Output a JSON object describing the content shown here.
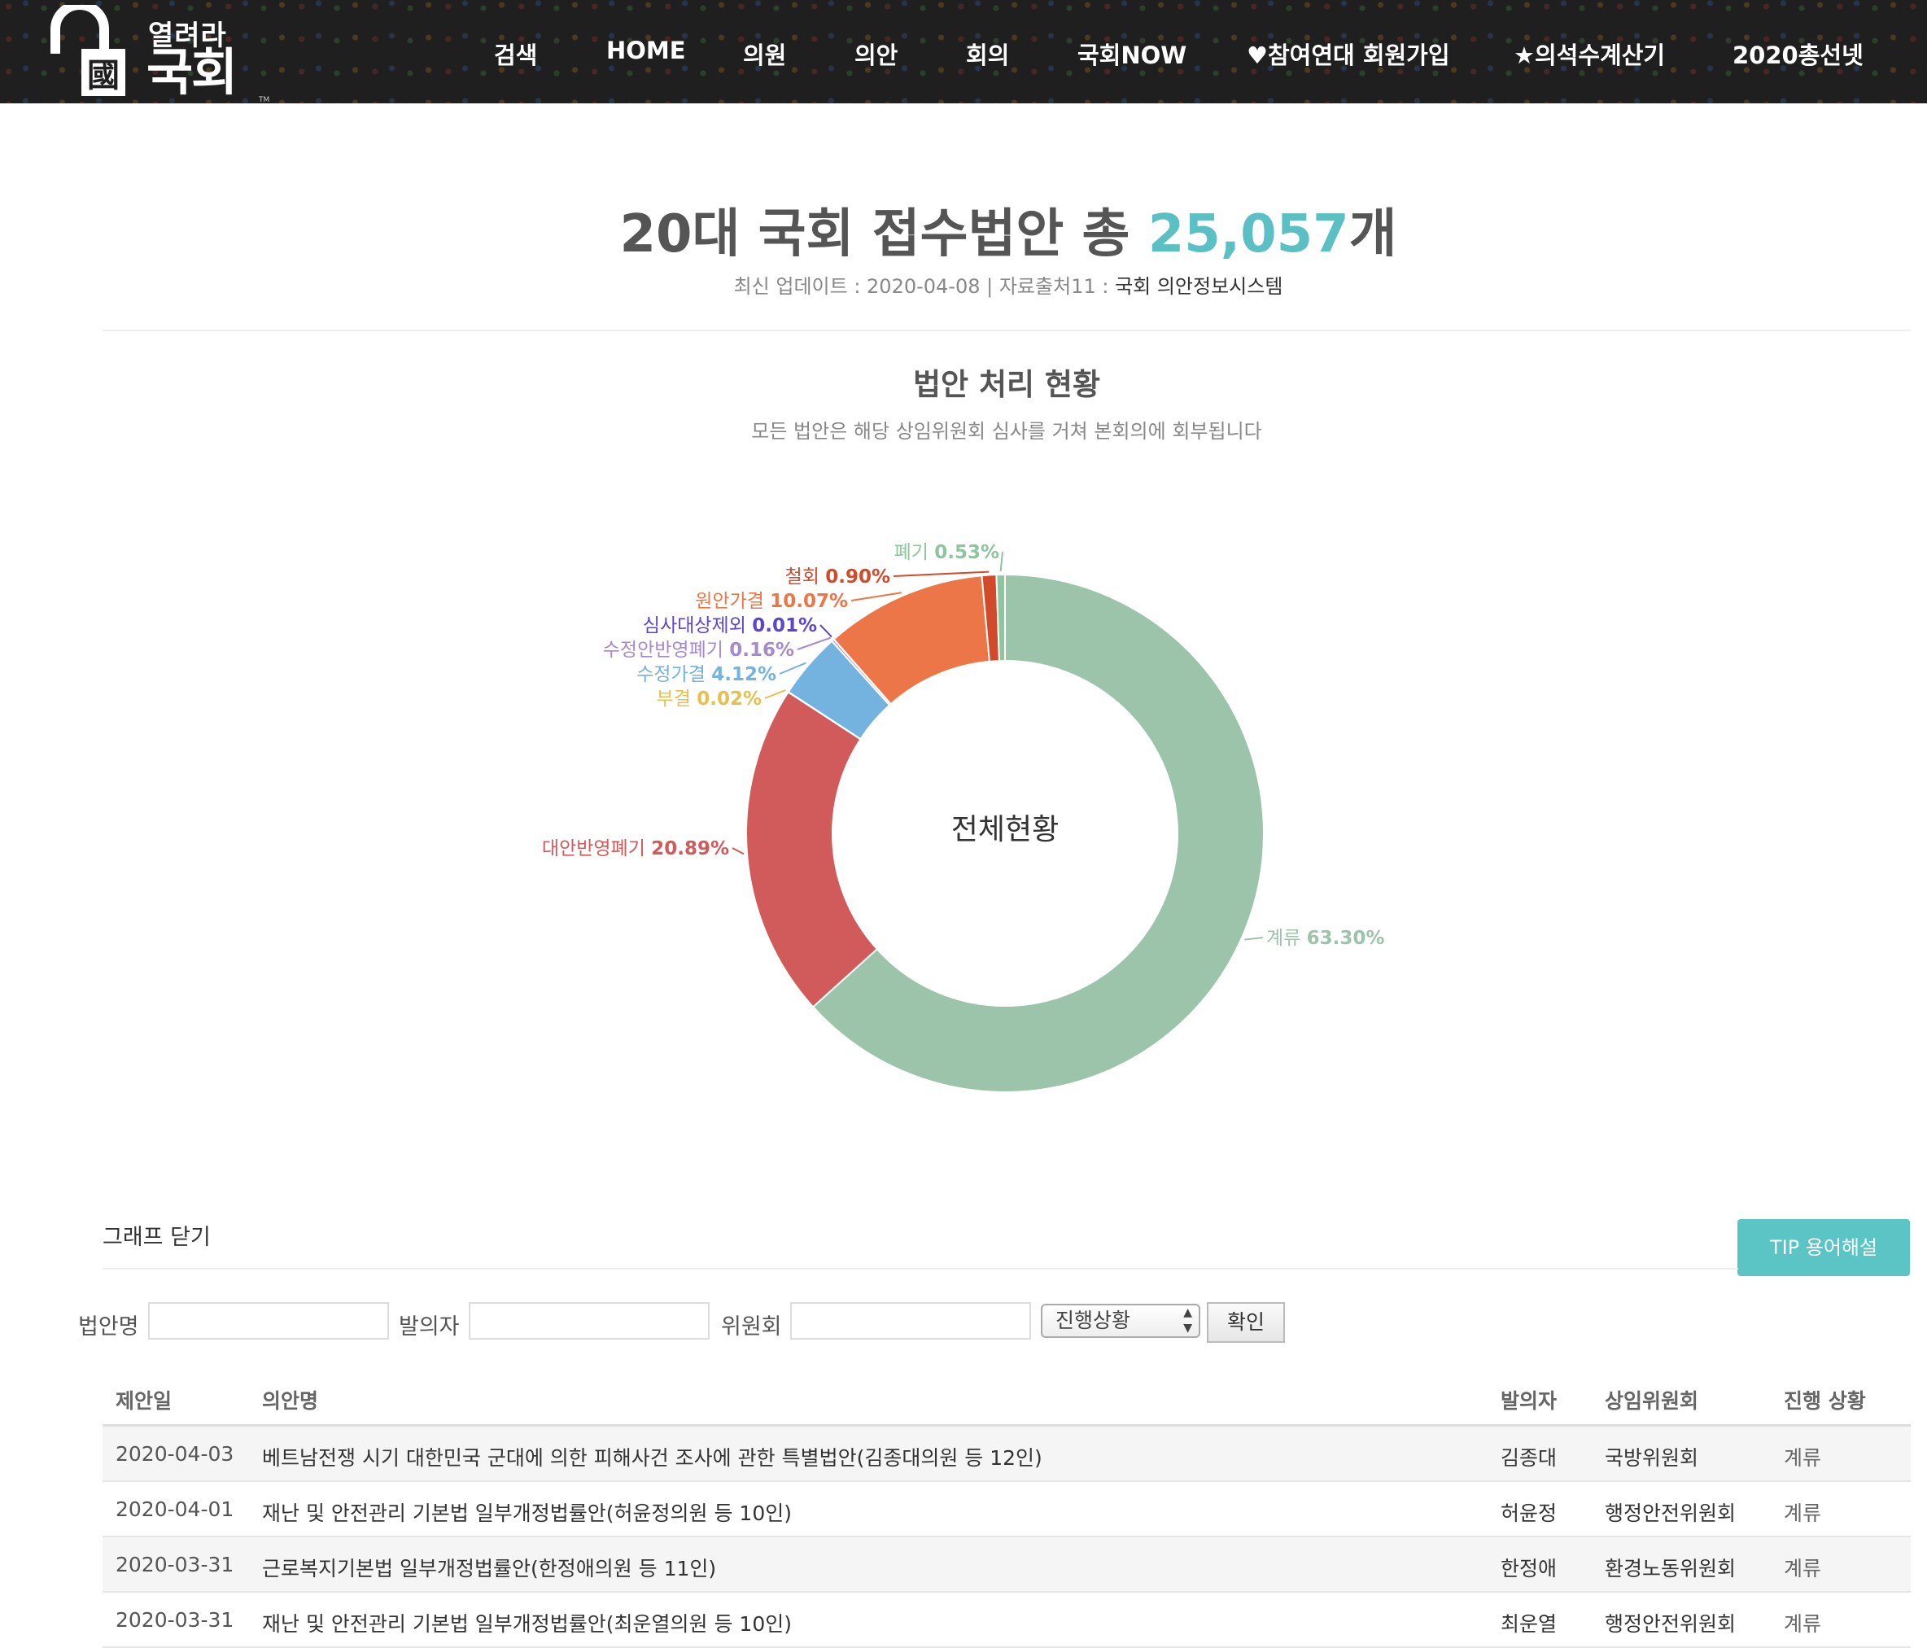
{
  "site": {
    "logo_small": "열려라",
    "logo_big": "국회",
    "logo_mark": "國",
    "logo_tm": "TM"
  },
  "nav": [
    {
      "label": "검색"
    },
    {
      "label": "HOME"
    },
    {
      "label": "의원"
    },
    {
      "label": "의안"
    },
    {
      "label": "회의"
    },
    {
      "label": "국회NOW"
    },
    {
      "label": "♥참여연대 회원가입"
    },
    {
      "label": "★의석수계산기"
    },
    {
      "label": "2020총선넷"
    }
  ],
  "headline": {
    "prefix": "20대 국회 접수법안 총 ",
    "count": "25,057",
    "suffix": "개"
  },
  "update": {
    "text": "최신 업데이트 : 2020-04-08 | 자료출처11 : ",
    "source": "국회 의안정보시스템"
  },
  "section": {
    "title": "법안 처리 현황",
    "subtitle": "모든 법안은 해당 상임위원회 심사를 거쳐 본회의에 회부됩니다"
  },
  "chart_data": {
    "type": "pie",
    "variant": "donut",
    "center_label": "전체현황",
    "slices": [
      {
        "label": "계류",
        "value": 63.3,
        "pct": "63.30%",
        "color": "#9bc4ab"
      },
      {
        "label": "대안반영폐기",
        "value": 20.89,
        "pct": "20.89%",
        "color": "#d15b5b"
      },
      {
        "label": "부결",
        "value": 0.02,
        "pct": "0.02%",
        "color": "#e6c04d"
      },
      {
        "label": "수정가결",
        "value": 4.12,
        "pct": "4.12%",
        "color": "#74b3e0"
      },
      {
        "label": "수정안반영폐기",
        "value": 0.16,
        "pct": "0.16%",
        "color": "#a78ac9"
      },
      {
        "label": "심사대상제외",
        "value": 0.01,
        "pct": "0.01%",
        "color": "#5a47c9"
      },
      {
        "label": "원안가결",
        "value": 10.07,
        "pct": "10.07%",
        "color": "#ec7647"
      },
      {
        "label": "철회",
        "value": 0.9,
        "pct": "0.90%",
        "color": "#d14a2a"
      },
      {
        "label": "폐기",
        "value": 0.53,
        "pct": "0.53%",
        "color": "#8ec49e"
      }
    ]
  },
  "controls": {
    "graph_close": "그래프 닫기",
    "tip": "TIP 용어해설",
    "filter": {
      "bill_label": "법안명",
      "proposer_label": "발의자",
      "committee_label": "위원회",
      "status_select": "진행상황",
      "confirm": "확인"
    }
  },
  "table": {
    "headers": [
      "제안일",
      "의안명",
      "발의자",
      "상임위원회",
      "진행 상황"
    ],
    "rows": [
      [
        "2020-04-03",
        "베트남전쟁 시기 대한민국 군대에 의한 피해사건 조사에 관한 특별법안(김종대의원 등 12인)",
        "김종대",
        "국방위원회",
        "계류"
      ],
      [
        "2020-04-01",
        "재난 및 안전관리 기본법 일부개정법률안(허윤정의원 등 10인)",
        "허윤정",
        "행정안전위원회",
        "계류"
      ],
      [
        "2020-03-31",
        "근로복지기본법 일부개정법률안(한정애의원 등 11인)",
        "한정애",
        "환경노동위원회",
        "계류"
      ],
      [
        "2020-03-31",
        "재난 및 안전관리 기본법 일부개정법률안(최운열의원 등 10인)",
        "최운열",
        "행정안전위원회",
        "계류"
      ]
    ]
  }
}
